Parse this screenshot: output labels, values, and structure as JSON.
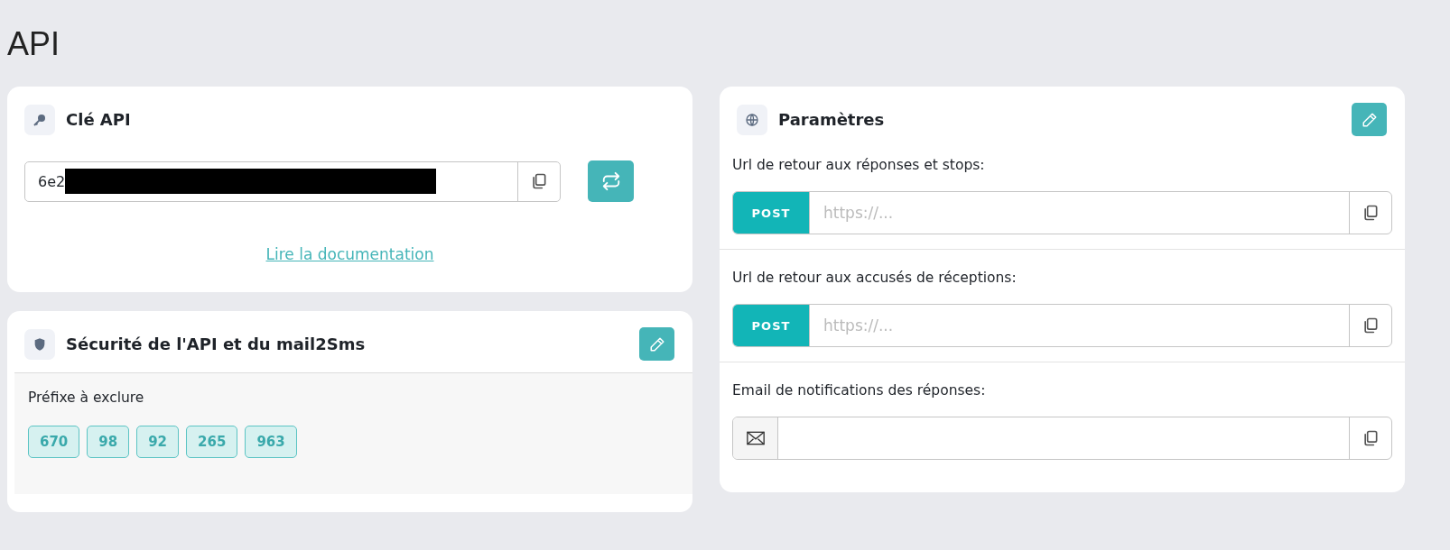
{
  "page_title": "API",
  "api_key": {
    "title": "Clé API",
    "value": "6e2",
    "redacted": true,
    "doc_link": "Lire la documentation"
  },
  "security": {
    "title": "Sécurité de l'API et du mail2Sms",
    "prefix_label": "Préfixe à exclure",
    "prefixes": [
      "670",
      "98",
      "92",
      "265",
      "963"
    ]
  },
  "settings": {
    "title": "Paramètres",
    "fields": [
      {
        "kind": "url",
        "label": "Url de retour aux réponses et stops:",
        "method": "POST",
        "placeholder": "https://..."
      },
      {
        "kind": "url",
        "label": "Url de retour aux accusés de réceptions:",
        "method": "POST",
        "placeholder": "https://..."
      },
      {
        "kind": "email",
        "label": "Email de notifications des réponses:"
      }
    ]
  }
}
